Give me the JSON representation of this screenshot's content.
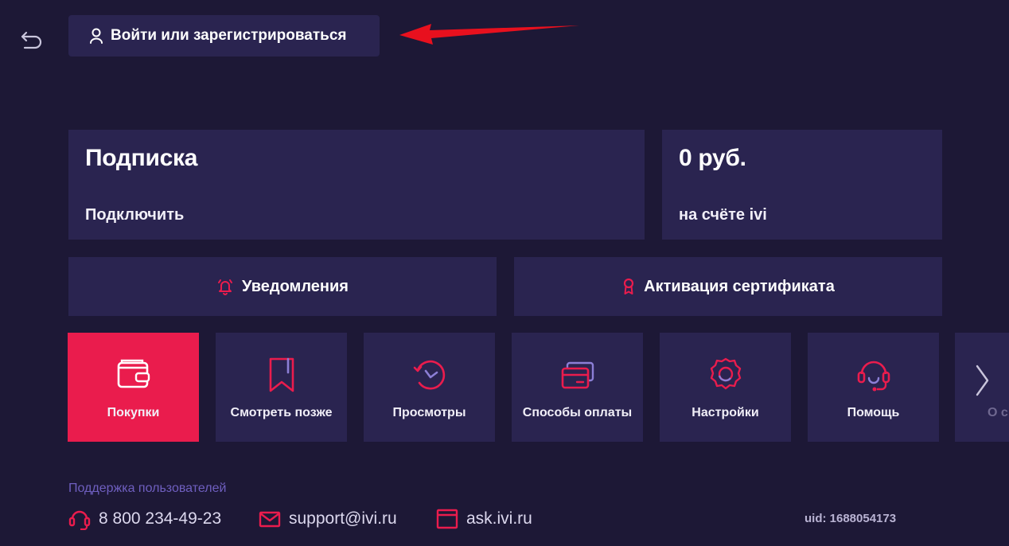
{
  "header": {
    "back_icon": "back-arrow-icon",
    "login_label": "Войти или зарегистрироваться",
    "login_icon": "user-icon"
  },
  "annotation": {
    "arrow_color": "#e8101e"
  },
  "subscription": {
    "title": "Подписка",
    "action": "Подключить"
  },
  "balance": {
    "amount": "0 руб.",
    "caption": "на счёте ivi"
  },
  "actions": {
    "notifications": {
      "label": "Уведомления",
      "icon": "bell-icon"
    },
    "certificate": {
      "label": "Активация сертификата",
      "icon": "award-icon"
    }
  },
  "tiles": [
    {
      "label": "Покупки",
      "icon": "wallet-icon",
      "active": true
    },
    {
      "label": "Смотреть позже",
      "icon": "bookmark-icon",
      "active": false
    },
    {
      "label": "Просмотры",
      "icon": "history-icon",
      "active": false
    },
    {
      "label": "Способы оплаты",
      "icon": "cards-icon",
      "active": false
    },
    {
      "label": "Настройки",
      "icon": "gear-icon",
      "active": false
    },
    {
      "label": "Помощь",
      "icon": "headset-icon",
      "active": false
    },
    {
      "label": "О с",
      "icon": "chevron-right-icon",
      "active": false
    }
  ],
  "support": {
    "title": "Поддержка пользователей",
    "phone": "8 800 234-49-23",
    "email": "support@ivi.ru",
    "site": "ask.ivi.ru",
    "uid": "uid: 1688054173"
  },
  "colors": {
    "background": "#1d1836",
    "panel": "#2a2450",
    "accent": "#ea1c4d",
    "support_title": "#6f5fc0"
  }
}
